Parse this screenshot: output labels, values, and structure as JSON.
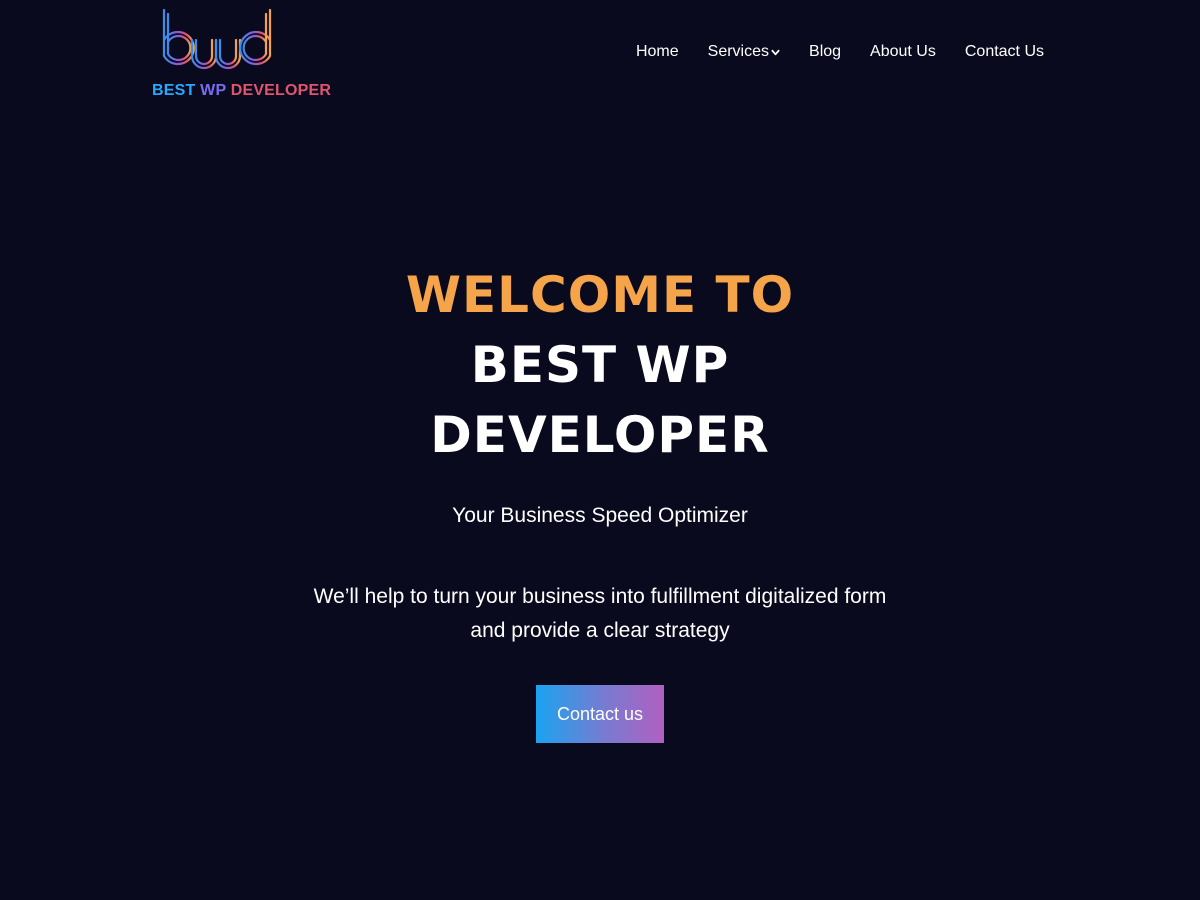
{
  "brand": {
    "logo_text_best": "BEST",
    "logo_text_wp": "WP",
    "logo_text_developer": "DEVELOPER",
    "logo_colors": [
      "#2aa7ff",
      "#7a6cf0",
      "#e0556e",
      "#f5a44a"
    ]
  },
  "nav": {
    "items": [
      {
        "label": "Home"
      },
      {
        "label": "Services",
        "icon": "chevron-down-icon"
      },
      {
        "label": "Blog"
      },
      {
        "label": "About Us"
      },
      {
        "label": "Contact Us"
      }
    ]
  },
  "hero": {
    "title_accent": "WELCOME TO",
    "title_main": "BEST WP DEVELOPER",
    "subtitle": "Your Business Speed Optimizer",
    "description": "We’ll help to turn your business into fulfillment digitalized form and provide a clear strategy",
    "cta_label": "Contact us"
  },
  "colors": {
    "background": "#0a0a1f",
    "accent": "#f5a44a",
    "text": "#ffffff",
    "cta_gradient_start": "#1aa3f0",
    "cta_gradient_end": "#b060c0"
  }
}
